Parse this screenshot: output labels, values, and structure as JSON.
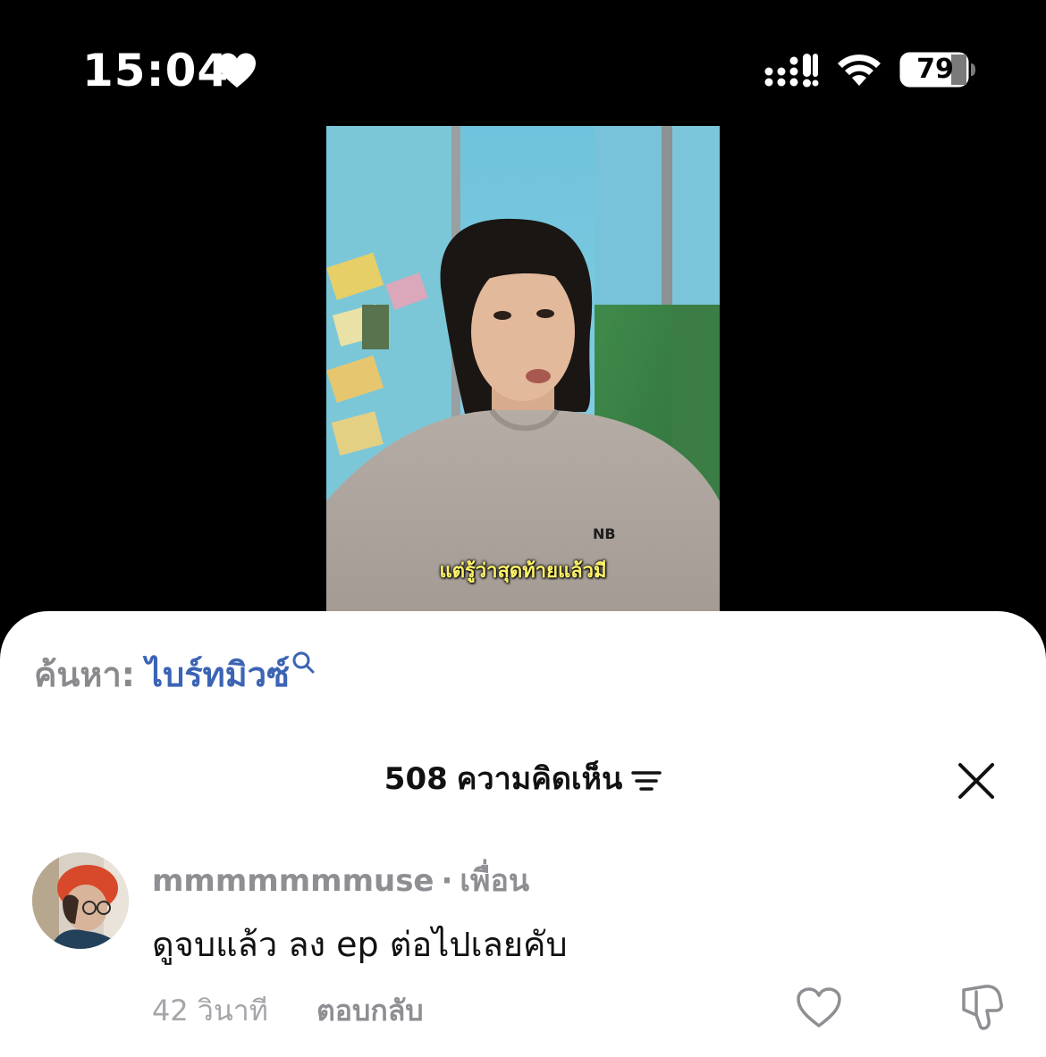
{
  "status_bar": {
    "time": "15:04",
    "battery": "79",
    "icons": [
      "heart-icon",
      "signal-icon",
      "wifi-icon",
      "battery-icon"
    ]
  },
  "video": {
    "subtitle": "แต่รู้ว่าสุดท้ายแล้วมี"
  },
  "search": {
    "prefix": "ค้นหา:",
    "term": "ไบร์ทมิวซ์"
  },
  "comments": {
    "count": "508",
    "label": "ความคิดเห็น",
    "items": [
      {
        "username": "mmmmmmmuse",
        "separator": "·",
        "relation": "เพื่อน",
        "text": "ดูจบแล้ว ลง ep ต่อไปเลยคับ",
        "time": "42 วินาที",
        "reply_label": "ตอบกลับ"
      }
    ]
  },
  "colors": {
    "search_term": "#3c64b4",
    "subtitle": "#fff36a",
    "muted": "#8e8e93"
  }
}
